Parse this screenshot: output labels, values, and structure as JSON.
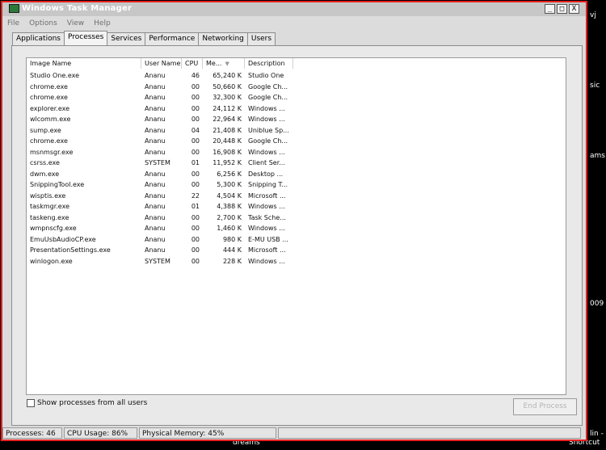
{
  "app": {
    "title": "Windows Task Manager",
    "window_buttons": {
      "minimize": "_",
      "maximize": "□",
      "close": "X"
    }
  },
  "menu": [
    "File",
    "Options",
    "View",
    "Help"
  ],
  "tabs": [
    "Applications",
    "Processes",
    "Services",
    "Performance",
    "Networking",
    "Users"
  ],
  "active_tab": "Processes",
  "table": {
    "columns": [
      "Image Name",
      "User Name",
      "CPU",
      "Me...",
      "Description"
    ],
    "sorted_by": "Me...",
    "rows": [
      [
        "Studio One.exe",
        "Ananu",
        "46",
        "65,240 K",
        "Studio One"
      ],
      [
        "chrome.exe",
        "Ananu",
        "00",
        "50,660 K",
        "Google Ch..."
      ],
      [
        "chrome.exe",
        "Ananu",
        "00",
        "32,300 K",
        "Google Ch..."
      ],
      [
        "explorer.exe",
        "Ananu",
        "00",
        "24,112 K",
        "Windows ..."
      ],
      [
        "wlcomm.exe",
        "Ananu",
        "00",
        "22,964 K",
        "Windows ..."
      ],
      [
        "sump.exe",
        "Ananu",
        "04",
        "21,408 K",
        "Uniblue Sp..."
      ],
      [
        "chrome.exe",
        "Ananu",
        "00",
        "20,448 K",
        "Google Ch..."
      ],
      [
        "msnmsgr.exe",
        "Ananu",
        "00",
        "16,908 K",
        "Windows ..."
      ],
      [
        "csrss.exe",
        "SYSTEM",
        "01",
        "11,952 K",
        "Client Ser..."
      ],
      [
        "dwm.exe",
        "Ananu",
        "00",
        "6,256 K",
        "Desktop ..."
      ],
      [
        "SnippingTool.exe",
        "Ananu",
        "00",
        "5,300 K",
        "Snipping T..."
      ],
      [
        "wisptis.exe",
        "Ananu",
        "22",
        "4,504 K",
        "Microsoft ..."
      ],
      [
        "taskmgr.exe",
        "Ananu",
        "01",
        "4,388 K",
        "Windows ..."
      ],
      [
        "taskeng.exe",
        "Ananu",
        "00",
        "2,700 K",
        "Task Sche..."
      ],
      [
        "wmpnscfg.exe",
        "Ananu",
        "00",
        "1,460 K",
        "Windows ..."
      ],
      [
        "EmuUsbAudioCP.exe",
        "Ananu",
        "00",
        "980 K",
        "E-MU USB ..."
      ],
      [
        "PresentationSettings.exe",
        "Ananu",
        "00",
        "444 K",
        "Microsoft ..."
      ],
      [
        "winlogon.exe",
        "SYSTEM",
        "00",
        "228 K",
        "Windows ..."
      ]
    ]
  },
  "footer": {
    "show_all_label": "Show processes from all users",
    "end_process_label": "End Process"
  },
  "status": {
    "processes": "Processes: 46",
    "cpu_usage": "CPU Usage: 86%",
    "physical_memory": "Physical Memory: 45%"
  },
  "desktop_fragments": [
    "vj",
    "sic",
    "ams",
    "009",
    "lin -",
    "dreams",
    "Shortcut"
  ]
}
